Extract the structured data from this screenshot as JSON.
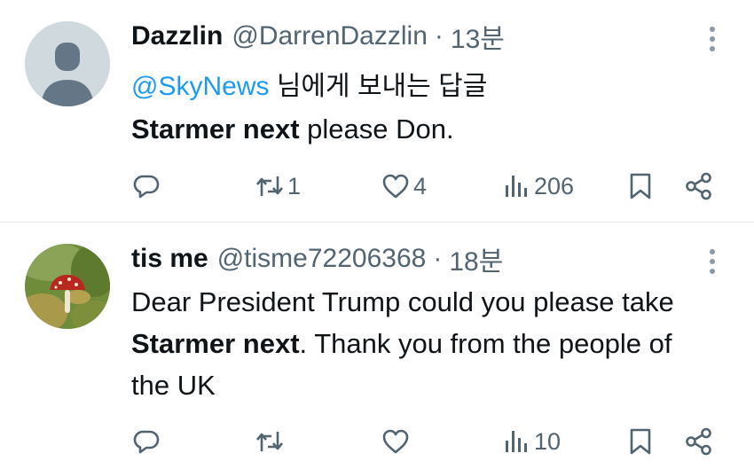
{
  "posts": [
    {
      "author_name": "Dazzlin",
      "handle": "@DarrenDazzlin",
      "separator": "·",
      "time": "13분",
      "reply_to_mention": "@SkyNews",
      "reply_to_suffix": " 님에게 보내는 답글",
      "text_bold": "Starmer next",
      "text_rest": " please Don.",
      "stats": {
        "reposts": "1",
        "likes": "4",
        "views": "206"
      },
      "avatar": "default-profile-avatar"
    },
    {
      "author_name": "tis me",
      "handle": "@tisme72206368",
      "separator": "·",
      "time": "18분",
      "text_part1": "Dear President Trump could you please take ",
      "text_bold": "Starmer next",
      "text_part2": ". Thank you from the people of the UK",
      "stats": {
        "reposts": "",
        "likes": "",
        "views": "10"
      },
      "avatar": "mushroom-photo-avatar"
    }
  ],
  "icons": [
    "reply-icon",
    "repost-icon",
    "like-icon",
    "views-icon",
    "bookmark-icon",
    "share-icon",
    "more-icon"
  ],
  "colors": {
    "text": "#0f1419",
    "secondary": "#536471",
    "link": "#1d9bf0",
    "divider": "#e8ebee"
  }
}
